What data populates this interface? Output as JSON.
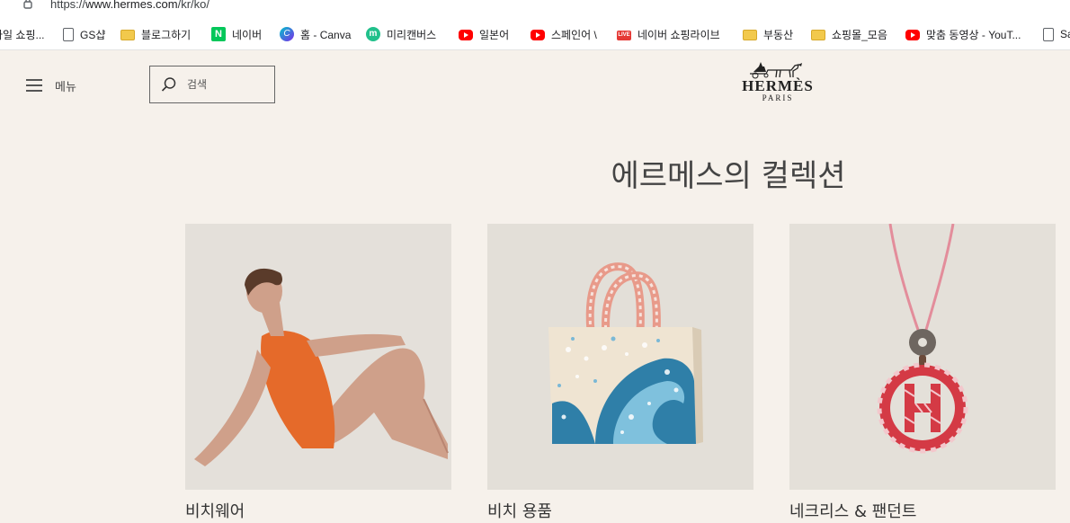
{
  "browser": {
    "url_prefix": "https://",
    "url_host": "www.hermes.com",
    "url_path": "/kr/ko/"
  },
  "bookmarks": [
    {
      "label": "파일 쇼핑...",
      "icon": "document-icon"
    },
    {
      "label": "GS샵",
      "icon": "document-icon"
    },
    {
      "label": "블로그하기",
      "icon": "folder-icon"
    },
    {
      "label": "네이버",
      "icon": "naver-icon"
    },
    {
      "label": "홈 - Canva",
      "icon": "canva-icon"
    },
    {
      "label": "미리캔버스",
      "icon": "miricanvas-icon"
    },
    {
      "label": "일본어",
      "icon": "youtube-icon"
    },
    {
      "label": "스페인어 \\",
      "icon": "youtube-icon"
    },
    {
      "label": "네이버 쇼핑라이브",
      "icon": "live-icon"
    },
    {
      "label": "부동산",
      "icon": "folder-icon"
    },
    {
      "label": "쇼핑몰_모음",
      "icon": "folder-icon"
    },
    {
      "label": "맞춤 동영상 - YouT...",
      "icon": "youtube-icon"
    },
    {
      "label": "Sa",
      "icon": "document-icon"
    }
  ],
  "header": {
    "menu_label": "메뉴",
    "search_placeholder": "검색",
    "logo_main": "HERMÈS",
    "logo_sub": "PARIS"
  },
  "collection": {
    "title": "에르메스의 컬렉션",
    "items": [
      {
        "label": "비치웨어"
      },
      {
        "label": "비치 용품"
      },
      {
        "label": "네크리스 & 팬던트"
      }
    ]
  }
}
